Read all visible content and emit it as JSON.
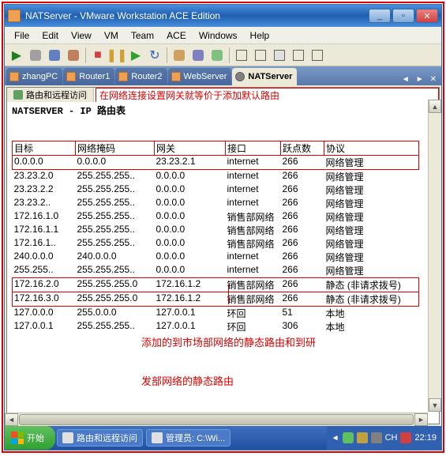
{
  "window": {
    "title": "NATServer - VMware Workstation ACE Edition",
    "controls": {
      "min": "_",
      "max": "▫",
      "close": "✕"
    }
  },
  "menu": {
    "items": [
      "File",
      "Edit",
      "View",
      "VM",
      "Team",
      "ACE",
      "Windows",
      "Help"
    ]
  },
  "tabs": {
    "items": [
      {
        "label": "zhangPC"
      },
      {
        "label": "Router1"
      },
      {
        "label": "Router2"
      },
      {
        "label": "WebServer"
      },
      {
        "label": "NATServer",
        "active": true
      }
    ]
  },
  "sub_tab": {
    "label": "路由和远程访问"
  },
  "annotation_top": "在网络连接设置网关就等价于添加默认路由",
  "console_title": "NATSERVER - IP 路由表",
  "headers": [
    "目标",
    "网络掩码",
    "网关",
    "接口",
    "跃点数",
    "协议"
  ],
  "routes": [
    {
      "d": "0.0.0.0",
      "m": "0.0.0.0",
      "g": "23.23.2.1",
      "i": "internet",
      "h": "266",
      "p": "网络管理",
      "hl": true
    },
    {
      "d": "23.23.2.0",
      "m": "255.255.255..",
      "g": "0.0.0.0",
      "i": "internet",
      "h": "266",
      "p": "网络管理"
    },
    {
      "d": "23.23.2.2",
      "m": "255.255.255..",
      "g": "0.0.0.0",
      "i": "internet",
      "h": "266",
      "p": "网络管理"
    },
    {
      "d": "23.23.2..",
      "m": "255.255.255..",
      "g": "0.0.0.0",
      "i": "internet",
      "h": "266",
      "p": "网络管理"
    },
    {
      "d": "172.16.1.0",
      "m": "255.255.255..",
      "g": "0.0.0.0",
      "i": "销售部网络",
      "h": "266",
      "p": "网络管理"
    },
    {
      "d": "172.16.1.1",
      "m": "255.255.255..",
      "g": "0.0.0.0",
      "i": "销售部网络",
      "h": "266",
      "p": "网络管理"
    },
    {
      "d": "172.16.1..",
      "m": "255.255.255..",
      "g": "0.0.0.0",
      "i": "销售部网络",
      "h": "266",
      "p": "网络管理"
    },
    {
      "d": "240.0.0.0",
      "m": "240.0.0.0",
      "g": "0.0.0.0",
      "i": "internet",
      "h": "266",
      "p": "网络管理"
    },
    {
      "d": "255.255..",
      "m": "255.255.255..",
      "g": "0.0.0.0",
      "i": "internet",
      "h": "266",
      "p": "网络管理"
    },
    {
      "d": "172.16.2.0",
      "m": "255.255.255.0",
      "g": "172.16.1.2",
      "i": "销售部网络",
      "h": "266",
      "p": "静态 (非请求拨号)",
      "hl": true
    },
    {
      "d": "172.16.3.0",
      "m": "255.255.255.0",
      "g": "172.16.1.2",
      "i": "销售部网络",
      "h": "266",
      "p": "静态 (非请求拨号)",
      "hl": true
    },
    {
      "d": "127.0.0.0",
      "m": "255.0.0.0",
      "g": "127.0.0.1",
      "i": "环回",
      "h": "51",
      "p": "本地"
    },
    {
      "d": "127.0.0.1",
      "m": "255.255.255..",
      "g": "127.0.0.1",
      "i": "环回",
      "h": "306",
      "p": "本地"
    }
  ],
  "annotation_bottom": {
    "l1": "添加的到市场部网络的静态路由和到研",
    "l2": "发部网络的静态路由"
  },
  "taskbar": {
    "start": "开始",
    "items": [
      {
        "label": "路由和远程访问"
      },
      {
        "label": "管理员: C:\\Wi..."
      }
    ],
    "clock": "22:19",
    "tray_icons": 4
  }
}
